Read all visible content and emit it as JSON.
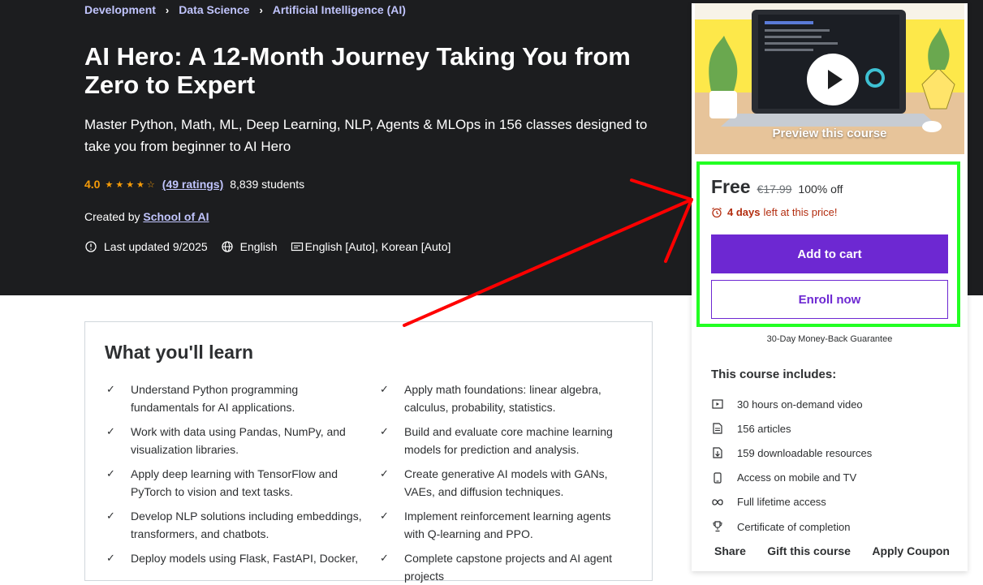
{
  "breadcrumb": [
    "Development",
    "Data Science",
    "Artificial Intelligence (AI)"
  ],
  "course": {
    "title": "AI Hero: A 12-Month Journey Taking You from Zero to Expert",
    "subtitle": "Master Python, Math, ML, Deep Learning, NLP, Agents & MLOps in 156 classes designed to take you from beginner to AI Hero",
    "rating": "4.0",
    "ratings_count": "(49 ratings)",
    "students": "8,839 students",
    "created_by_label": "Created by",
    "author": "School of AI",
    "last_updated": "Last updated 9/2025",
    "language": "English",
    "captions": "English [Auto], Korean [Auto]"
  },
  "learn": {
    "title": "What you'll learn",
    "items": [
      "Understand Python programming fundamentals for AI applications.",
      "Apply math foundations: linear algebra, calculus, probability, statistics.",
      "Work with data using Pandas, NumPy, and visualization libraries.",
      "Build and evaluate core machine learning models for prediction and analysis.",
      "Apply deep learning with TensorFlow and PyTorch to vision and text tasks.",
      "Create generative AI models with GANs, VAEs, and diffusion techniques.",
      "Develop NLP solutions including embeddings, transformers, and chatbots.",
      "Implement reinforcement learning agents with Q-learning and PPO.",
      "Deploy models using Flask, FastAPI, Docker,",
      "Complete capstone projects and AI agent projects"
    ]
  },
  "sidebar": {
    "preview_label": "Preview this course",
    "price": "Free",
    "original_price": "€17.99",
    "discount": "100% off",
    "urgency_days": "4 days",
    "urgency_text": "left at this price!",
    "add_to_cart": "Add to cart",
    "enroll_now": "Enroll now",
    "guarantee": "30-Day Money-Back Guarantee",
    "includes_title": "This course includes:",
    "includes": [
      {
        "icon": "video-icon",
        "text": "30 hours on-demand video"
      },
      {
        "icon": "article-icon",
        "text": "156 articles"
      },
      {
        "icon": "download-icon",
        "text": "159 downloadable resources"
      },
      {
        "icon": "mobile-icon",
        "text": "Access on mobile and TV"
      },
      {
        "icon": "infinity-icon",
        "text": "Full lifetime access"
      },
      {
        "icon": "trophy-icon",
        "text": "Certificate of completion"
      }
    ],
    "links": [
      "Share",
      "Gift this course",
      "Apply Coupon"
    ]
  },
  "colors": {
    "hero_bg": "#1c1d1f",
    "accent": "#6d28d2",
    "star": "#f69c08",
    "highlight": "#22ff22",
    "arrow": "#ff0000"
  }
}
